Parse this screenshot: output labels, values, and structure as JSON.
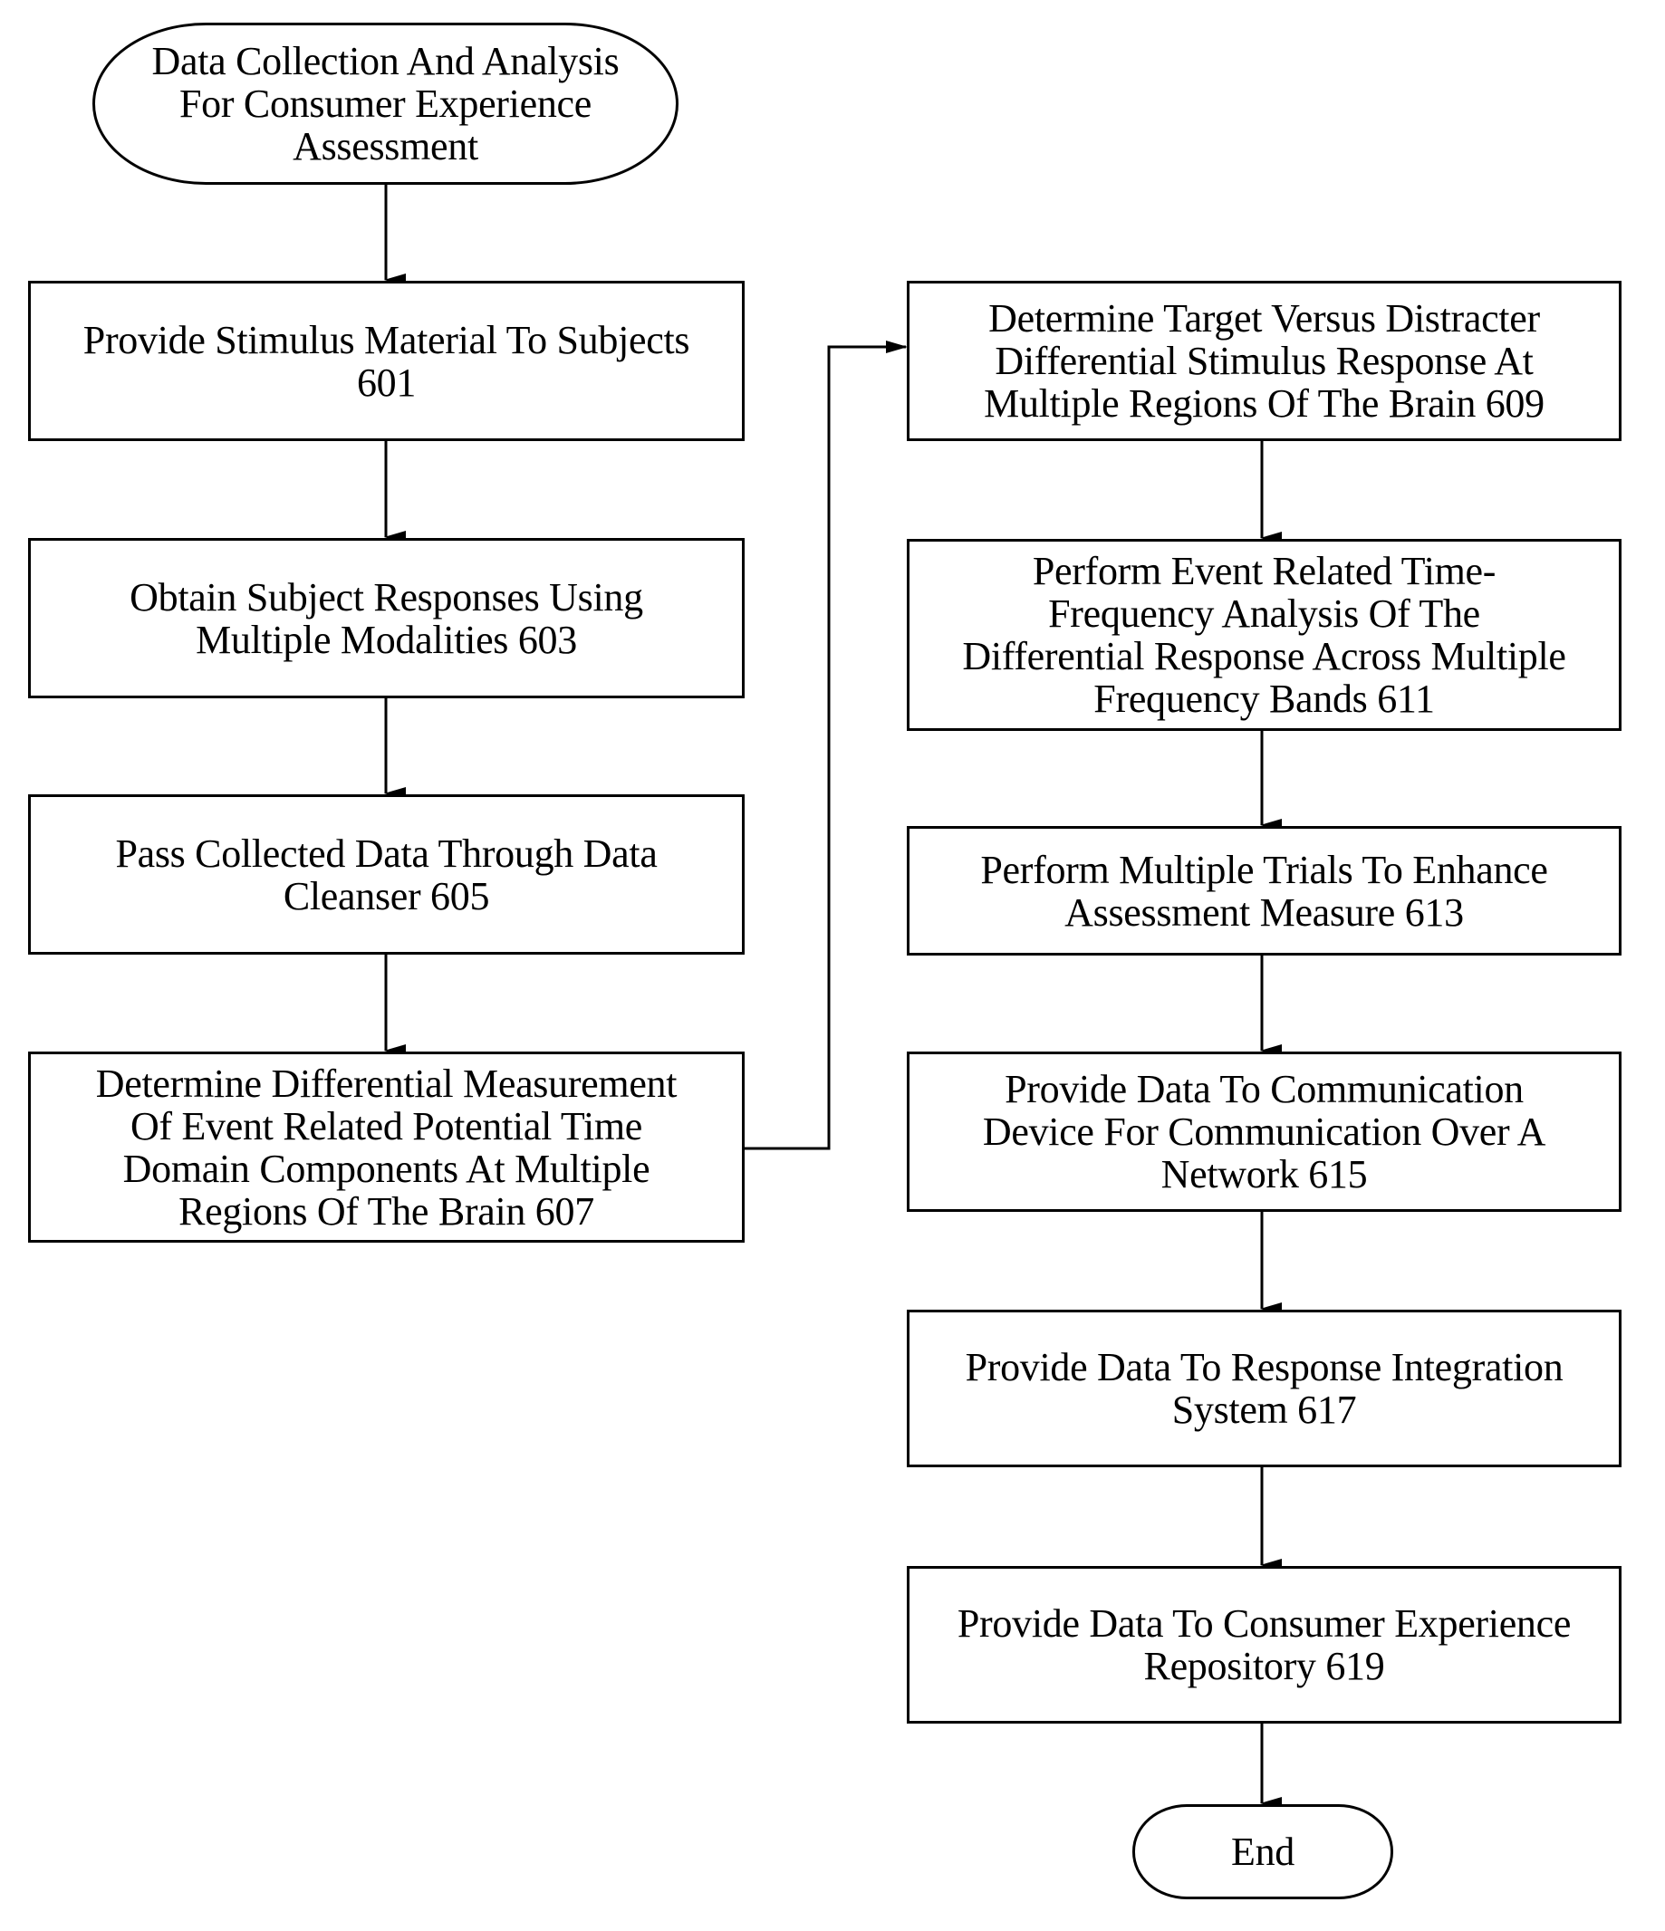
{
  "diagram": {
    "type": "flowchart",
    "start": {
      "label": "Data Collection And Analysis\nFor Consumer Experience\nAssessment"
    },
    "end": {
      "label": "End"
    },
    "steps": [
      {
        "id": "601",
        "label": "Provide Stimulus Material To Subjects\n601"
      },
      {
        "id": "603",
        "label": "Obtain Subject Responses Using\nMultiple Modalities 603"
      },
      {
        "id": "605",
        "label": "Pass Collected Data Through Data\nCleanser 605"
      },
      {
        "id": "607",
        "label": "Determine Differential Measurement\nOf Event Related Potential Time\nDomain Components At Multiple\nRegions Of The Brain 607"
      },
      {
        "id": "609",
        "label": "Determine Target Versus Distracter\nDifferential Stimulus Response At\nMultiple Regions Of The Brain 609"
      },
      {
        "id": "611",
        "label": "Perform Event Related Time-\nFrequency Analysis Of The\nDifferential Response Across Multiple\nFrequency Bands 611"
      },
      {
        "id": "613",
        "label": "Perform Multiple Trials To Enhance\nAssessment Measure 613"
      },
      {
        "id": "615",
        "label": "Provide Data To Communication\nDevice For Communication Over A\nNetwork 615"
      },
      {
        "id": "617",
        "label": "Provide Data To Response Integration\nSystem 617"
      },
      {
        "id": "619",
        "label": "Provide Data To Consumer Experience\nRepository 619"
      }
    ],
    "edges": [
      [
        "start",
        "601"
      ],
      [
        "601",
        "603"
      ],
      [
        "603",
        "605"
      ],
      [
        "605",
        "607"
      ],
      [
        "607",
        "609"
      ],
      [
        "609",
        "611"
      ],
      [
        "611",
        "613"
      ],
      [
        "613",
        "615"
      ],
      [
        "615",
        "617"
      ],
      [
        "617",
        "619"
      ],
      [
        "619",
        "end"
      ]
    ]
  }
}
